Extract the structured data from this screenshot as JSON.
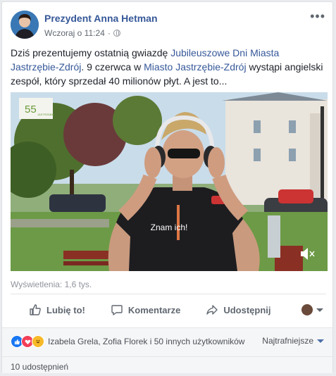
{
  "post": {
    "author": "Prezydent Anna Hetman",
    "timestamp": "Wczoraj o 11:24",
    "more_label": "•••",
    "text_before": "Dziś prezentujemy ostatnią gwiazdę ",
    "link1": "Jubileuszowe Dni Miasta Jastrzębie-Zdrój",
    "text_mid": ". 9 czerwca w ",
    "link2": "Miasto Jastrzębie-Zdrój",
    "text_after": " wystąpi angielski zespół, który sprzedał 40 milionów płyt. A jest to..."
  },
  "video": {
    "logo_text": "55",
    "logo_subtext": "JASTRZĘBIE",
    "subtitle": "Znam ich!",
    "views": "Wyświetlenia: 1,6 tys."
  },
  "actions": {
    "like": "Lubię to!",
    "comment": "Komentarze",
    "share": "Udostępnij"
  },
  "reactions": {
    "summary": "Izabela Grela, Zofia Florek i 50 innych użytkowników",
    "sort": "Najtrafniejsze",
    "shares": "10 udostępnień",
    "icons": [
      "like-reaction-icon",
      "love-reaction-icon",
      "haha-reaction-icon"
    ]
  },
  "colors": {
    "link": "#365899",
    "like_blue": "#1877f2",
    "love_red": "#f33e58",
    "haha_yellow": "#f7b928"
  }
}
